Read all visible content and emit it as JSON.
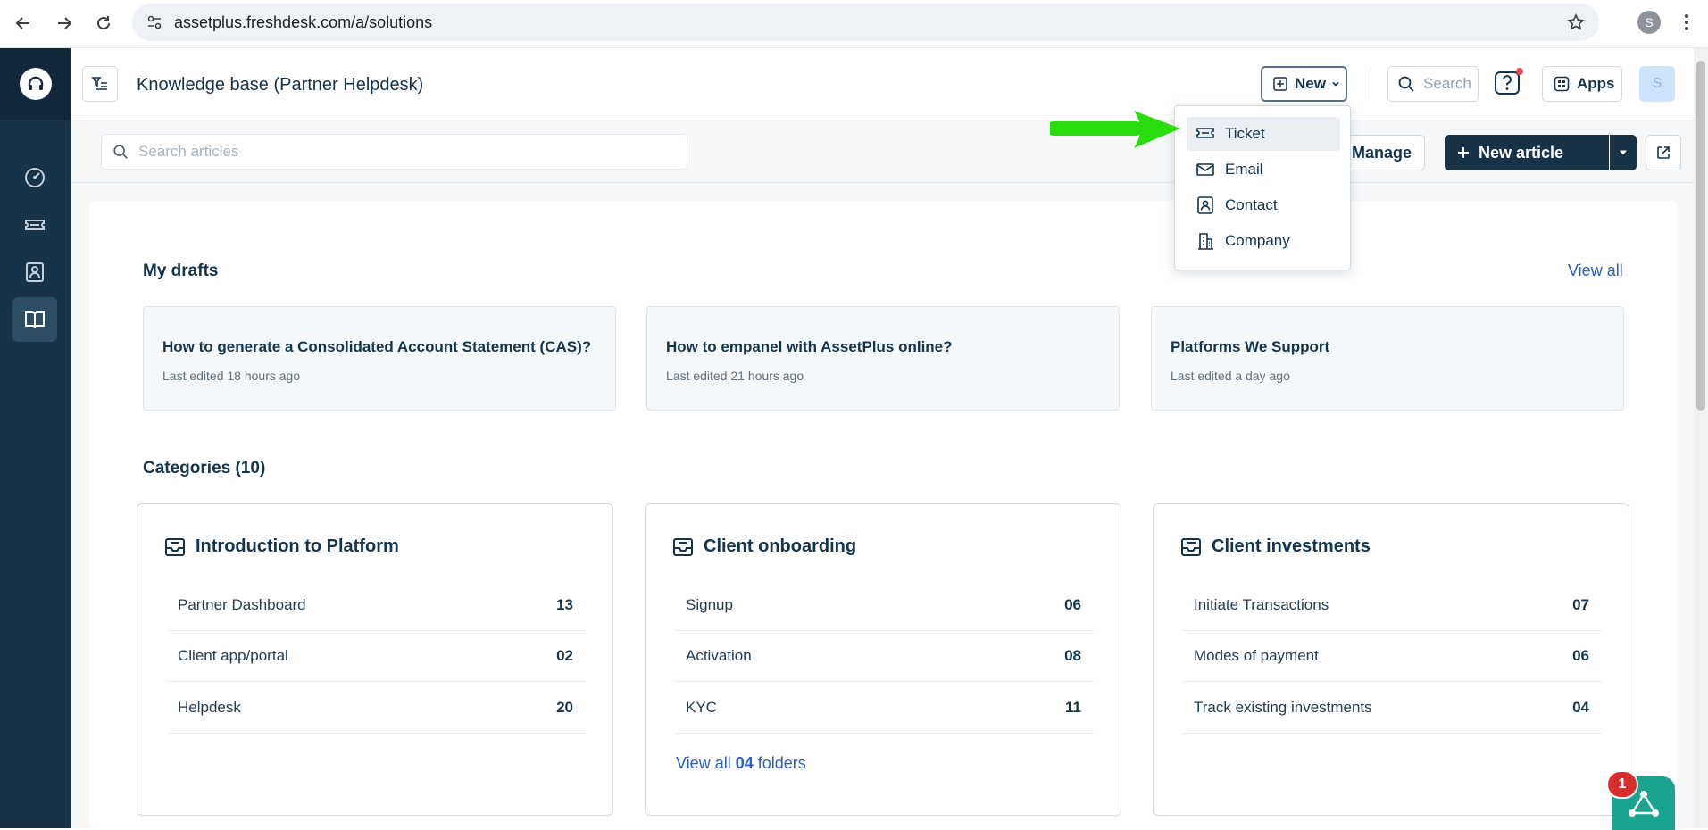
{
  "browser": {
    "url": "assetplus.freshdesk.com/a/solutions",
    "profile_initial": "S"
  },
  "header": {
    "title": "Knowledge base (Partner Helpdesk)",
    "new_label": "New",
    "search_label": "Search",
    "apps_label": "Apps",
    "avatar_initial": "S"
  },
  "new_menu": {
    "items": [
      {
        "label": "Ticket",
        "icon": "ticket-icon"
      },
      {
        "label": "Email",
        "icon": "email-icon"
      },
      {
        "label": "Contact",
        "icon": "contact-icon"
      },
      {
        "label": "Company",
        "icon": "company-icon"
      }
    ]
  },
  "toolbar": {
    "search_placeholder": "Search articles",
    "manage_label": "Manage",
    "new_article_label": "New article"
  },
  "drafts": {
    "title": "My drafts",
    "view_all": "View all",
    "items": [
      {
        "title": "How to generate a Consolidated Account Statement (CAS)?",
        "meta": "Last edited 18 hours ago"
      },
      {
        "title": "How to empanel with AssetPlus online?",
        "meta": "Last edited 21 hours ago"
      },
      {
        "title": "Platforms We Support",
        "meta": "Last edited a day ago"
      }
    ]
  },
  "categories": {
    "title": "Categories (10)",
    "items": [
      {
        "name": "Introduction to Platform",
        "folders": [
          {
            "name": "Partner Dashboard",
            "count": "13"
          },
          {
            "name": "Client app/portal",
            "count": "02"
          },
          {
            "name": "Helpdesk",
            "count": "20"
          }
        ]
      },
      {
        "name": "Client onboarding",
        "folders": [
          {
            "name": "Signup",
            "count": "06"
          },
          {
            "name": "Activation",
            "count": "08"
          },
          {
            "name": "KYC",
            "count": "11"
          }
        ],
        "view_all_prefix": "View all",
        "view_all_count": "04",
        "view_all_suffix": "folders"
      },
      {
        "name": "Client investments",
        "folders": [
          {
            "name": "Initiate Transactions",
            "count": "07"
          },
          {
            "name": "Modes of payment",
            "count": "06"
          },
          {
            "name": "Track existing investments",
            "count": "04"
          }
        ]
      }
    ]
  },
  "widget": {
    "badge": "1"
  },
  "colors": {
    "sidebar": "#183247",
    "primary": "#183247",
    "link": "#2c5cc5",
    "arrow": "#2bdc0f",
    "widget": "#1aa38e"
  }
}
